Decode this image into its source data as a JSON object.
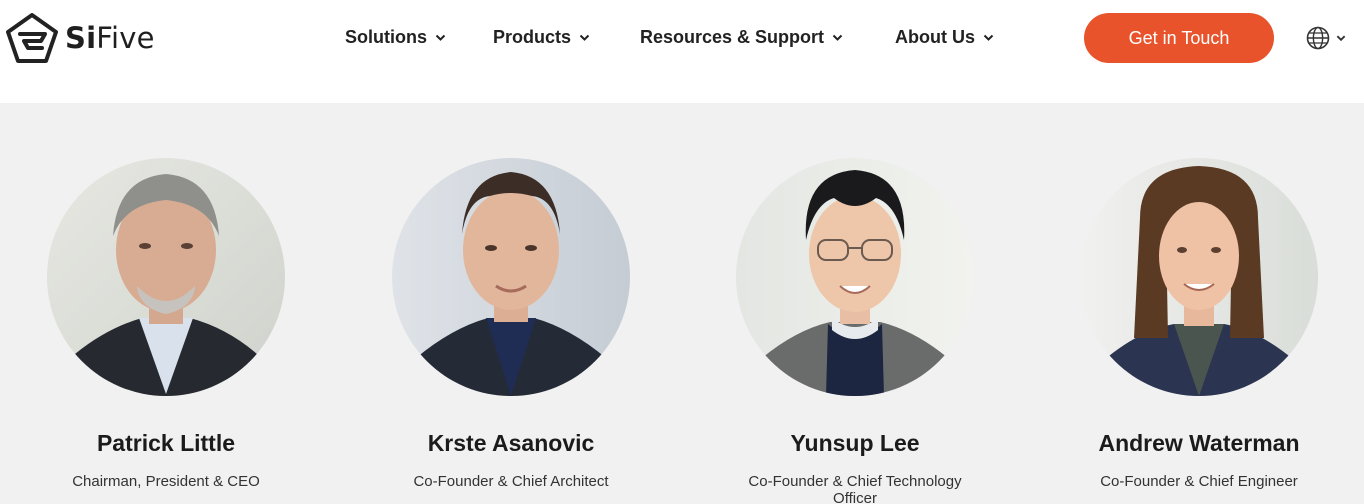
{
  "brand": {
    "name_bold": "Si",
    "name_light": "Five"
  },
  "nav": {
    "items": [
      {
        "label": "Solutions"
      },
      {
        "label": "Products"
      },
      {
        "label": "Resources & Support"
      },
      {
        "label": "About Us"
      }
    ],
    "cta_label": "Get in Touch"
  },
  "colors": {
    "accent": "#e8532b",
    "page_bg": "#f1f1f1",
    "header_bg": "#ffffff"
  },
  "team": [
    {
      "name": "Patrick Little",
      "title": "Chairman, President & CEO"
    },
    {
      "name": "Krste Asanovic",
      "title": "Co-Founder & Chief Architect"
    },
    {
      "name": "Yunsup Lee",
      "title": "Co-Founder & Chief Technology Officer"
    },
    {
      "name": "Andrew Waterman",
      "title": "Co-Founder & Chief Engineer"
    }
  ]
}
